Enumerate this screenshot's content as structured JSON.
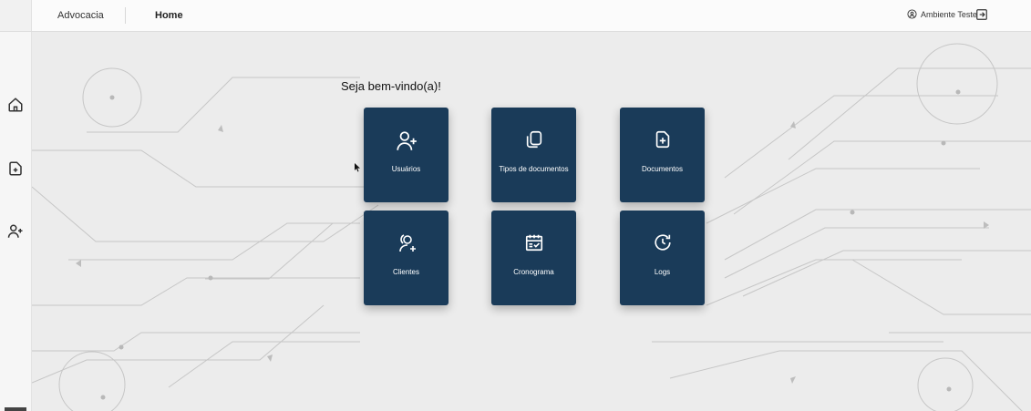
{
  "header": {
    "app_name": "Advocacia",
    "page_title": "Home",
    "user_label": "Ambiente Teste"
  },
  "sidebar": {
    "items": [
      {
        "icon": "home-icon"
      },
      {
        "icon": "file-plus-icon"
      },
      {
        "icon": "user-plus-icon"
      }
    ]
  },
  "main": {
    "welcome": "Seja bem-vindo(a)!",
    "tiles": [
      {
        "label": "Usuários",
        "icon": "user-plus-icon"
      },
      {
        "label": "Tipos de documentos",
        "icon": "copy-icon"
      },
      {
        "label": "Documentos",
        "icon": "file-plus-icon"
      },
      {
        "label": "Clientes",
        "icon": "users-plus-icon"
      },
      {
        "label": "Cronograma",
        "icon": "calendar-check-icon"
      },
      {
        "label": "Logs",
        "icon": "history-icon"
      }
    ]
  },
  "colors": {
    "tile": "#1a3b59",
    "background": "#ececec",
    "circuit_line": "#c4c4c4"
  }
}
